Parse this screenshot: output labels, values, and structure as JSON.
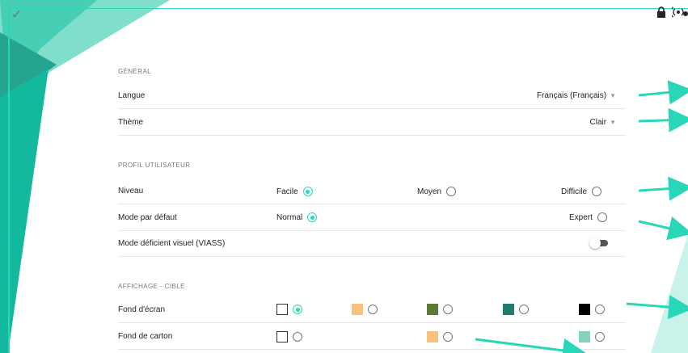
{
  "toolbar": {
    "check_icon": "check-icon",
    "lock_icon": "lock-icon",
    "radio_icon": "radio-signal-icon"
  },
  "sections": {
    "general": {
      "title": "GÉNÉRAL",
      "langue": {
        "label": "Langue",
        "value": "Français (Français)"
      },
      "theme": {
        "label": "Thème",
        "value": "Clair"
      }
    },
    "profil": {
      "title": "PROFIL UTILISATEUR",
      "niveau": {
        "label": "Niveau",
        "options": [
          {
            "label": "Facile",
            "selected": true
          },
          {
            "label": "Moyen",
            "selected": false
          },
          {
            "label": "Difficile",
            "selected": false
          }
        ]
      },
      "mode": {
        "label": "Mode par défaut",
        "options": [
          {
            "label": "Normal",
            "selected": true
          },
          {
            "label": "Expert",
            "selected": false
          }
        ]
      },
      "viass": {
        "label": "Mode déficient visuel (VIASS)",
        "enabled": false
      }
    },
    "affichage": {
      "title": "AFFICHAGE - CIBLE",
      "fond_ecran": {
        "label": "Fond d'écran",
        "swatches": [
          {
            "color": "#ffffff",
            "selected": true
          },
          {
            "color": "#f9c27c",
            "selected": false
          },
          {
            "color": "#5a7a35",
            "selected": false
          },
          {
            "color": "#1f7c6e",
            "selected": false
          },
          {
            "color": "#000000",
            "selected": false
          }
        ]
      },
      "fond_carton": {
        "label": "Fond de carton",
        "swatches": [
          {
            "color": "#ffffff",
            "selected": false
          },
          {
            "color": "#f9c27c",
            "selected": false
          },
          {
            "color": "#86d2c0",
            "selected": false
          }
        ]
      }
    }
  },
  "colors": {
    "accent": "#2ad6b8",
    "accent_dark": "#1c9e8a"
  }
}
